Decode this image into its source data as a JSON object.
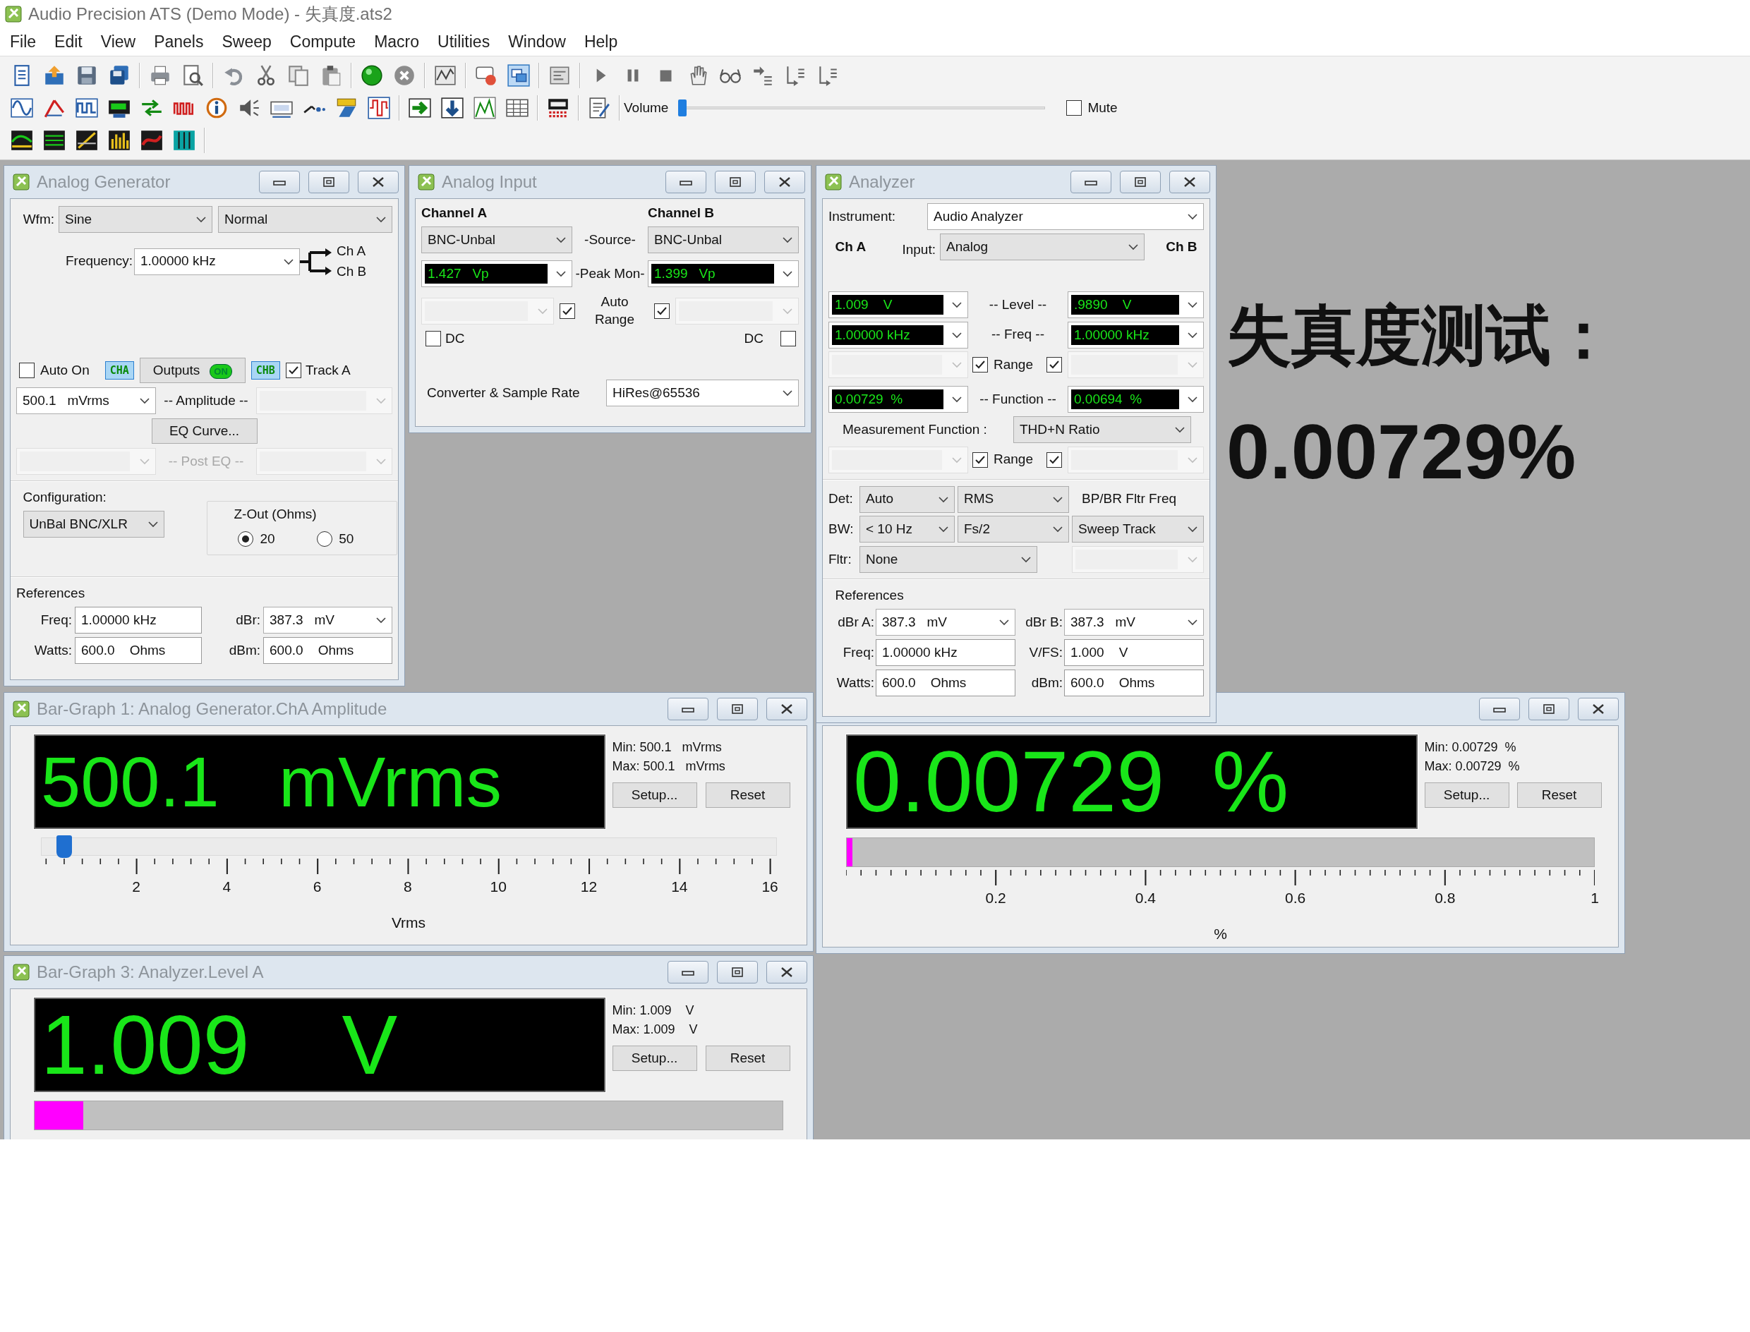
{
  "window": {
    "title": "Audio Precision ATS (Demo Mode) - 失真度.ats2"
  },
  "menu": [
    "File",
    "Edit",
    "View",
    "Panels",
    "Sweep",
    "Compute",
    "Macro",
    "Utilities",
    "Window",
    "Help"
  ],
  "toolbar": {
    "volume_label": "Volume",
    "volume": {
      "level": 0
    },
    "mute": {
      "label": "Mute",
      "checked": false
    }
  },
  "analog_generator": {
    "title": "Analog Generator",
    "wfm_label": "Wfm:",
    "waveform": "Sine",
    "mode": "Normal",
    "frequency_label": "Frequency:",
    "frequency": "1.00000 kHz",
    "routes": [
      "Ch A",
      "Ch B"
    ],
    "auto_on": {
      "label": "Auto On",
      "checked": false
    },
    "cha_badge": "CHA",
    "outputs": {
      "label": "Outputs",
      "indicator": "ON",
      "on": true
    },
    "chb_badge": "CHB",
    "track_a": {
      "label": "Track A",
      "checked": true
    },
    "amplitude": "500.1   mVrms",
    "amplitude_label": "-- Amplitude --",
    "eq_button": "EQ Curve...",
    "post_eq_label": "-- Post EQ --",
    "configuration_label": "Configuration:",
    "configuration": "UnBal BNC/XLR",
    "zout_label": "Z-Out (Ohms)",
    "zout_options": [
      {
        "label": "20",
        "selected": true
      },
      {
        "label": "50",
        "selected": false
      }
    ],
    "references_label": "References",
    "references": [
      {
        "label": "Freq:",
        "value": "1.00000 kHz",
        "kind": "text"
      },
      {
        "label": "dBr:",
        "value": "387.3   mV",
        "kind": "dropdown"
      },
      {
        "label": "Watts:",
        "value": "600.0    Ohms",
        "kind": "text"
      },
      {
        "label": "dBm:",
        "value": "600.0    Ohms",
        "kind": "text"
      }
    ]
  },
  "analog_input": {
    "title": "Analog Input",
    "channel_a": "Channel A",
    "channel_b": "Channel B",
    "source_label": "-Source-",
    "source_a": "BNC-Unbal",
    "source_b": "BNC-Unbal",
    "peak_label": "-Peak Mon-",
    "peak_a": "1.427   Vp",
    "peak_b": "1.399   Vp",
    "auto_range_label": "Auto Range",
    "auto_range_a": {
      "checked": true
    },
    "auto_range_b": {
      "checked": true
    },
    "dc_a": {
      "label": "DC",
      "checked": false
    },
    "dc_b": {
      "label": "DC",
      "checked": false
    },
    "converter_label": "Converter & Sample Rate",
    "converter": "HiRes@65536"
  },
  "analyzer": {
    "title": "Analyzer",
    "instrument_label": "Instrument:",
    "instrument": "Audio Analyzer",
    "ch_a": "Ch A",
    "input_label": "Input:",
    "input": "Analog",
    "ch_b": "Ch B",
    "readings": [
      {
        "label": "-- Level --",
        "a": "1.009    V",
        "b": ".9890    V"
      },
      {
        "label": "-- Freq --",
        "a": "1.00000 kHz",
        "b": "1.00000 kHz"
      }
    ],
    "range_1": {
      "label": "Range",
      "checked_a": true,
      "checked_b": true
    },
    "function_reading": {
      "label": "-- Function --",
      "a": "0.00729  %",
      "b": "0.00694  %"
    },
    "measurement_function_label": "Measurement Function :",
    "measurement_function": "THD+N Ratio",
    "range_2": {
      "label": "Range",
      "checked_a": true,
      "checked_b": true
    },
    "det_label": "Det:",
    "det": "Auto",
    "det_mode": "RMS",
    "bp_label": "BP/BR Fltr Freq",
    "bw_label": "BW:",
    "bw_low": "< 10 Hz",
    "bw_high": "Fs/2",
    "bp_filter": "Sweep Track",
    "fltr_label": "Fltr:",
    "fltr": "None",
    "references_label": "References",
    "references": [
      {
        "label": "dBr A:",
        "value": "387.3   mV",
        "kind": "dropdown"
      },
      {
        "label": "dBr B:",
        "value": "387.3   mV",
        "kind": "dropdown"
      },
      {
        "label": "Freq:",
        "value": "1.00000 kHz",
        "kind": "text"
      },
      {
        "label": "V/FS:",
        "value": "1.000    V",
        "kind": "text"
      },
      {
        "label": "Watts:",
        "value": "600.0    Ohms",
        "kind": "text"
      },
      {
        "label": "dBm:",
        "value": "600.0    Ohms",
        "kind": "text"
      }
    ]
  },
  "bar_graphs": [
    {
      "title": "Bar-Graph 1: Analog Generator.ChA Amplitude",
      "reading": "500.1   mVrms",
      "min": "Min: 500.1   mVrms",
      "max": "Max: 500.1   mVrms",
      "setup": "Setup...",
      "reset": "Reset",
      "kind": "slider",
      "level": 0.031,
      "ticks": [
        "2",
        "4",
        "6",
        "8",
        "10",
        "12",
        "14",
        "16"
      ],
      "axis_label": "Vrms"
    },
    {
      "reading": "0.00729  %",
      "min": "Min: 0.00729  %",
      "max": "Max: 0.00729  %",
      "setup": "Setup...",
      "reset": "Reset",
      "kind": "bar",
      "level": 0.008,
      "ticks": [
        "0.2",
        "0.4",
        "0.6",
        "0.8",
        "1"
      ],
      "axis_label": "%"
    },
    {
      "title": "Bar-Graph 3: Analyzer.Level A",
      "reading": "1.009    V",
      "min": "Min: 1.009    V",
      "max": "Max: 1.009    V",
      "setup": "Setup...",
      "reset": "Reset",
      "kind": "bar",
      "level": 0.065
    }
  ],
  "annotation": {
    "title": "失真度测试：",
    "value": "0.00729%"
  }
}
